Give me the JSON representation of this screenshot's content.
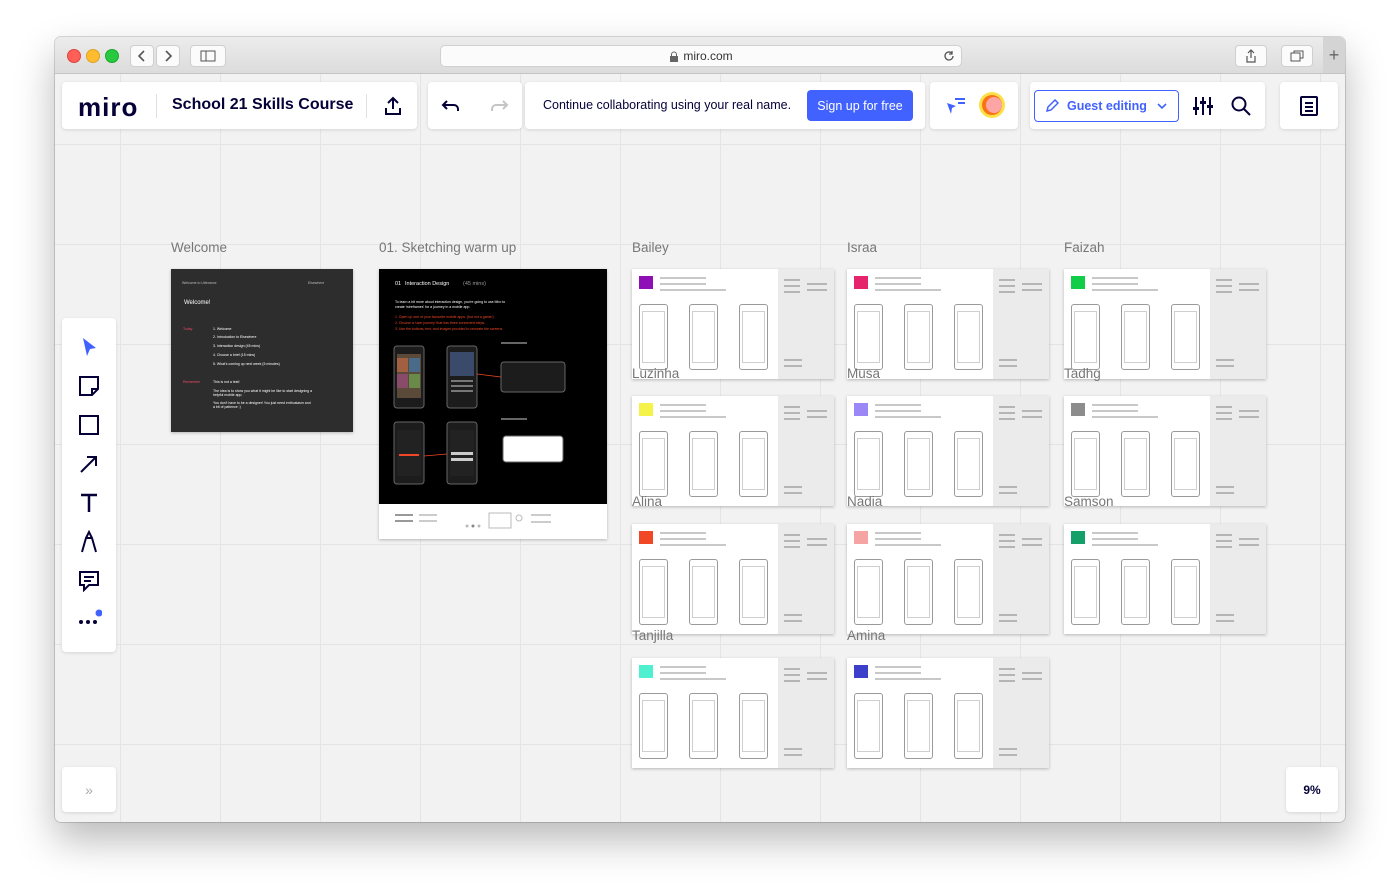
{
  "browser": {
    "url": "miro.com",
    "new_tab": "+"
  },
  "topbar": {
    "logo": "miro",
    "board_title": "School 21 Skills Course",
    "collab_message": "Continue collaborating using your real name.",
    "signup_label": "Sign up for free",
    "guest_label": "Guest editing",
    "accent": "#4262ff"
  },
  "toolbar": {
    "tools": [
      "select-icon",
      "sticky-note-icon",
      "shape-icon",
      "arrow-icon",
      "text-icon",
      "pen-icon",
      "comment-icon",
      "more-icon"
    ]
  },
  "frames": {
    "welcome": {
      "label": "Welcome",
      "header_left": "Welcome to Utterance",
      "header_right": "Elsewhere",
      "heading": "Welcome!",
      "today": "Today",
      "agenda": [
        "1. Welcome",
        "2. Introduction to Elsewhere",
        "3. Interaction design (45 mins)",
        "4. Choose a brief (15 mins)",
        "5. What's coming up next week (5 minutes)"
      ],
      "remember": "Remember",
      "notes": [
        "This is not a test!",
        "The idea is to show you what it might be like to start designing a helpful mobile app.",
        "You don't have to be a designer! You just need enthusiasm and a bit of patience :)"
      ]
    },
    "sketching": {
      "label": "01. Sketching warm up",
      "heading_num": "01",
      "heading": "Interaction Design",
      "heading_time": "(45 mins)",
      "intro": "To learn a bit more about interaction design, you're going to use Miro to create 'wireframes' for a journey in a mobile app.",
      "steps": [
        "1. Open up one of your favourite mobile apps. (but not a game!)",
        "2. Choose a 'user journey' that has three connected steps.",
        "3. Use the buttons, text, and images provided to recreate the screens."
      ]
    },
    "students": [
      {
        "name": "Bailey",
        "color": "#8e0fb5"
      },
      {
        "name": "Israa",
        "color": "#e6246c"
      },
      {
        "name": "Faizah",
        "color": "#12cd48"
      },
      {
        "name": "Luzinha",
        "color": "#f5f24a"
      },
      {
        "name": "Musa",
        "color": "#9b87f5"
      },
      {
        "name": "Tadhg",
        "color": "#8c8c8c"
      },
      {
        "name": "Alina",
        "color": "#f24726"
      },
      {
        "name": "Nadia",
        "color": "#f5a3a3"
      },
      {
        "name": "Samson",
        "color": "#15a06a"
      },
      {
        "name": "Tanjilla",
        "color": "#4ff0d0"
      },
      {
        "name": "Amina",
        "color": "#3b3fc9"
      }
    ]
  },
  "zoom": "9%",
  "expand": "»"
}
